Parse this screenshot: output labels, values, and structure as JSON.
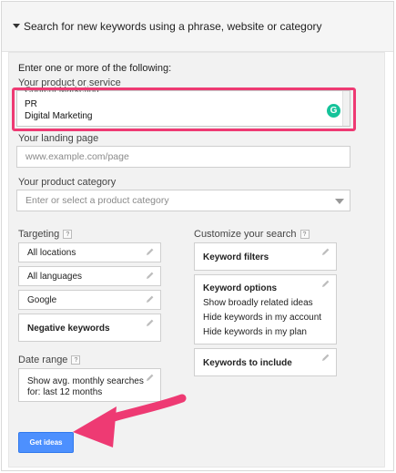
{
  "header": {
    "title": "Search for new keywords using a phrase, website or category"
  },
  "form": {
    "intro": "Enter one or more of the following:",
    "product_label": "Your product or service",
    "product_lines": [
      "PR",
      "Digital Marketing"
    ],
    "product_cut_line": "Content Marketing",
    "grammarly_icon": "grammarly-icon",
    "landing_label": "Your landing page",
    "landing_placeholder": "www.example.com/page",
    "category_label": "Your product category",
    "category_placeholder": "Enter or select a product category"
  },
  "targeting": {
    "label": "Targeting",
    "help": "?",
    "items": [
      "All locations",
      "All languages",
      "Google",
      "Negative keywords"
    ]
  },
  "date_range": {
    "label": "Date range",
    "help": "?",
    "text_line1": "Show avg. monthly searches",
    "text_line2": "for: last 12 months"
  },
  "customize": {
    "label": "Customize your search",
    "help": "?",
    "keyword_filters": "Keyword filters",
    "keyword_options": {
      "title": "Keyword options",
      "options": [
        "Show broadly related ideas",
        "Hide keywords in my account",
        "Hide keywords in my plan"
      ]
    },
    "keywords_to_include": "Keywords to include"
  },
  "actions": {
    "get_ideas": "Get ideas"
  },
  "colors": {
    "highlight": "#ee3a73",
    "button": "#4d90fe",
    "arrow": "#ee3a73"
  }
}
